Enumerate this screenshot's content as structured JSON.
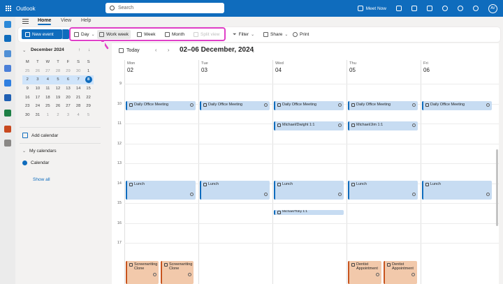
{
  "app": {
    "name": "Outlook"
  },
  "search": {
    "placeholder": "Search"
  },
  "topbar": {
    "meet_now": "Meet Now",
    "avatar_initials": "AV"
  },
  "menu": {
    "tabs": [
      "Home",
      "View",
      "Help"
    ],
    "active": "Home"
  },
  "ribbon": {
    "new_event": "New event",
    "views": [
      {
        "label": "Day",
        "icon": "day-view-icon"
      },
      {
        "label": "Work week",
        "icon": "work-week-icon",
        "selected": true
      },
      {
        "label": "Week",
        "icon": "week-view-icon"
      },
      {
        "label": "Month",
        "icon": "month-view-icon"
      },
      {
        "label": "Split view",
        "icon": "split-view-icon",
        "disabled": true
      }
    ],
    "filter": "Filter",
    "share": "Share",
    "print": "Print"
  },
  "mini_calendar": {
    "month_label": "December 2024",
    "weekdays": [
      "M",
      "T",
      "W",
      "T",
      "F",
      "S",
      "S"
    ],
    "weeks": [
      [
        "25",
        "26",
        "27",
        "28",
        "29",
        "30",
        "1"
      ],
      [
        "2",
        "3",
        "4",
        "5",
        "6",
        "7",
        "8"
      ],
      [
        "9",
        "10",
        "11",
        "12",
        "13",
        "14",
        "15"
      ],
      [
        "16",
        "17",
        "18",
        "19",
        "20",
        "21",
        "22"
      ],
      [
        "23",
        "24",
        "25",
        "26",
        "27",
        "28",
        "29"
      ],
      [
        "30",
        "31",
        "1",
        "2",
        "3",
        "4",
        "5"
      ]
    ],
    "selected_week": 1,
    "today": "8"
  },
  "left_pane": {
    "add_calendar": "Add calendar",
    "my_calendars": "My calendars",
    "calendar_name": "Calendar",
    "show_all": "Show all"
  },
  "calendar": {
    "today_label": "Today",
    "range": "02–06 December, 2024",
    "days": [
      {
        "name": "Mon",
        "num": "02"
      },
      {
        "name": "Tue",
        "num": "03"
      },
      {
        "name": "Wed",
        "num": "04"
      },
      {
        "name": "Thu",
        "num": "05"
      },
      {
        "name": "Fri",
        "num": "06"
      }
    ],
    "hours": [
      "9",
      "10",
      "11",
      "12",
      "13",
      "14",
      "15",
      "16",
      "17"
    ],
    "events": {
      "daily_office_meeting": "Daily Office Meeting",
      "michael_dwight": "Michael/Dwight 1:1",
      "michael_jim": "Michael/Jim 1:1",
      "lunch": "Lunch",
      "michael_toby": "Michael/Toby 1:1",
      "screenwriting_clone": "Screenwriting Clone",
      "dentist_appointment": "Dentist Appointment"
    }
  },
  "colors": {
    "brand": "#0f6cbd",
    "event_blue": "#c7dcf2",
    "event_orange": "#f2c9ab",
    "annotation_pink": "#e040c8"
  }
}
